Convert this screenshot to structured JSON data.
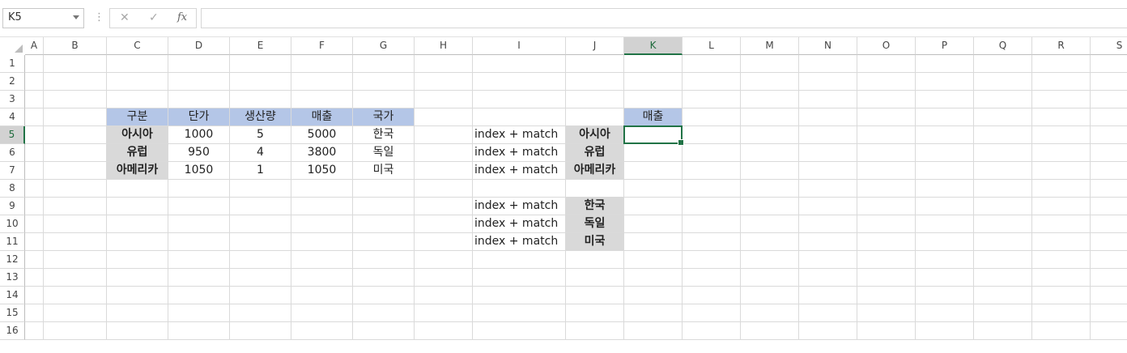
{
  "formula_bar": {
    "name_box": "K5",
    "cancel_icon": "✕",
    "enter_icon": "✓",
    "fx_label": "fx",
    "formula": ""
  },
  "columns": [
    "A",
    "B",
    "C",
    "D",
    "E",
    "F",
    "G",
    "H",
    "I",
    "J",
    "K",
    "L",
    "M",
    "N",
    "O",
    "P",
    "Q",
    "R",
    "S"
  ],
  "rows": [
    "1",
    "2",
    "3",
    "4",
    "5",
    "6",
    "7",
    "8",
    "9",
    "10",
    "11",
    "12",
    "13",
    "14",
    "15",
    "16"
  ],
  "active_cell": "K5",
  "cells": [
    {
      "ref": "C4",
      "text": "구분",
      "style": "blue",
      "align": "center"
    },
    {
      "ref": "D4",
      "text": "단가",
      "style": "blue",
      "align": "center"
    },
    {
      "ref": "E4",
      "text": "생산량",
      "style": "blue",
      "align": "center"
    },
    {
      "ref": "F4",
      "text": "매출",
      "style": "blue",
      "align": "center"
    },
    {
      "ref": "G4",
      "text": "국가",
      "style": "blue",
      "align": "center"
    },
    {
      "ref": "K4",
      "text": "매출",
      "style": "blue",
      "align": "center"
    },
    {
      "ref": "C5",
      "text": "아시아",
      "style": "gray",
      "bold": true,
      "align": "center"
    },
    {
      "ref": "D5",
      "text": "1000",
      "align": "center"
    },
    {
      "ref": "E5",
      "text": "5",
      "align": "center"
    },
    {
      "ref": "F5",
      "text": "5000",
      "align": "center"
    },
    {
      "ref": "G5",
      "text": "한국",
      "align": "center"
    },
    {
      "ref": "I5",
      "text": "index + match",
      "align": "left"
    },
    {
      "ref": "J5",
      "text": "아시아",
      "style": "gray",
      "bold": true,
      "align": "center"
    },
    {
      "ref": "C6",
      "text": "유럽",
      "style": "gray",
      "bold": true,
      "align": "center"
    },
    {
      "ref": "D6",
      "text": "950",
      "align": "center"
    },
    {
      "ref": "E6",
      "text": "4",
      "align": "center"
    },
    {
      "ref": "F6",
      "text": "3800",
      "align": "center"
    },
    {
      "ref": "G6",
      "text": "독일",
      "align": "center"
    },
    {
      "ref": "I6",
      "text": "index + match",
      "align": "left"
    },
    {
      "ref": "J6",
      "text": "유럽",
      "style": "gray",
      "bold": true,
      "align": "center"
    },
    {
      "ref": "C7",
      "text": "아메리카",
      "style": "gray",
      "bold": true,
      "align": "center"
    },
    {
      "ref": "D7",
      "text": "1050",
      "align": "center"
    },
    {
      "ref": "E7",
      "text": "1",
      "align": "center"
    },
    {
      "ref": "F7",
      "text": "1050",
      "align": "center"
    },
    {
      "ref": "G7",
      "text": "미국",
      "align": "center"
    },
    {
      "ref": "I7",
      "text": "index + match",
      "align": "left"
    },
    {
      "ref": "J7",
      "text": "아메리카",
      "style": "gray",
      "bold": true,
      "align": "center"
    },
    {
      "ref": "I9",
      "text": "index + match",
      "align": "left"
    },
    {
      "ref": "J9",
      "text": "한국",
      "style": "gray",
      "bold": true,
      "align": "center"
    },
    {
      "ref": "I10",
      "text": "index + match",
      "align": "left"
    },
    {
      "ref": "J10",
      "text": "독일",
      "style": "gray",
      "bold": true,
      "align": "center"
    },
    {
      "ref": "I11",
      "text": "index + match",
      "align": "left"
    },
    {
      "ref": "J11",
      "text": "미국",
      "style": "gray",
      "bold": true,
      "align": "center"
    }
  ],
  "colors": {
    "header_blue": "#b4c6e7",
    "label_gray": "#d9d9d9",
    "excel_green": "#217346"
  }
}
